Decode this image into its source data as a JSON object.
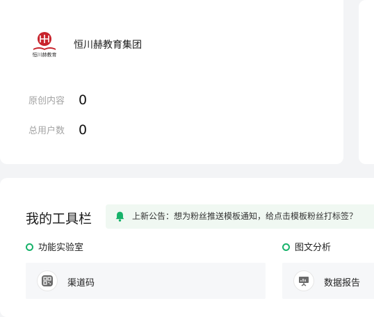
{
  "profile": {
    "org_name": "恒川赫教育集团",
    "logo_text": "恒川赫教育",
    "stats": [
      {
        "label": "原创内容",
        "value": "0"
      },
      {
        "label": "总用户数",
        "value": "0"
      }
    ]
  },
  "toolbar": {
    "title": "我的工具栏",
    "notice": "上新公告：想为粉丝推送模板通知，给点击模板粉丝打标签？",
    "sections": [
      {
        "label": "功能实验室",
        "items": [
          {
            "label": "渠道码",
            "icon": "qrcode-icon"
          }
        ]
      },
      {
        "label": "图文分析",
        "items": [
          {
            "label": "数据报告",
            "icon": "presentation-chart-icon"
          }
        ]
      }
    ]
  },
  "colors": {
    "accent": "#17b26a",
    "notice_bg": "#f0f8f2",
    "logo_red": "#c8232c"
  }
}
